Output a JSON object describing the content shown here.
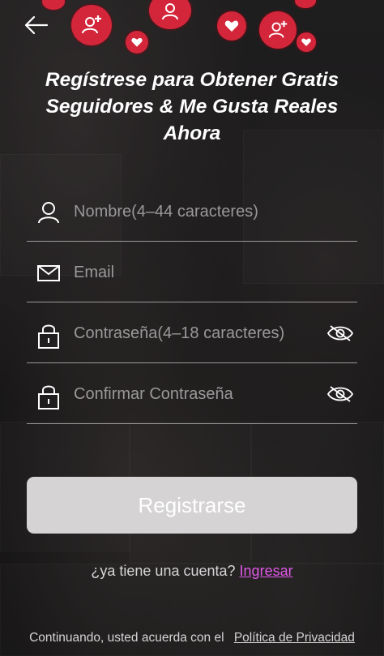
{
  "header": {
    "title": "Regístrese para Obtener Gratis Seguidores & Me Gusta Reales Ahora"
  },
  "form": {
    "name_placeholder": "Nombre(4–44 caracteres)",
    "email_placeholder": "Email",
    "password_placeholder": "Contraseña(4–18 caracteres)",
    "confirm_placeholder": "Confirmar Contraseña"
  },
  "actions": {
    "register_label": "Registrarse"
  },
  "login": {
    "prompt": "¿ya tiene una cuenta?",
    "link": "Ingresar"
  },
  "footer": {
    "text": "Continuando, usted acuerda con el",
    "link": "Política de Privacidad"
  },
  "colors": {
    "accent_badge": "#d3263a",
    "link": "#e057e7",
    "button_bg": "#d5d3d4"
  },
  "icons": [
    "back-arrow-icon",
    "user-icon",
    "mail-icon",
    "lock-icon",
    "eye-off-icon",
    "add-user-icon",
    "heart-plus-icon"
  ]
}
